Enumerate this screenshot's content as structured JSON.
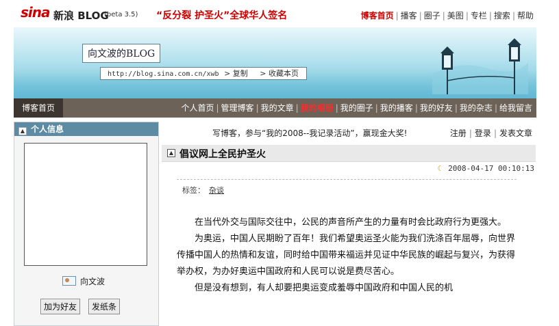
{
  "topbar": {
    "logo": "sina",
    "brand": "新浪 BLOG",
    "beta": "(beta 3.5)",
    "slogan": "“反分裂 护圣火”全球华人签名",
    "nav": [
      "博客首页",
      "播客",
      "圈子",
      "美图",
      "专栏",
      "搜索",
      "帮助"
    ]
  },
  "banner": {
    "blog_title": "向文波的BLOG",
    "url": "http://blog.sina.com.cn/xwb",
    "copy_label": "> 复制",
    "bookmark_label": "> 收藏本页"
  },
  "navbar": {
    "home": "博客首页",
    "links": [
      "个人首页",
      "管理博客",
      "我的文章",
      "我的相册",
      "我的圈子",
      "我的播客",
      "我的好友",
      "我的杂志",
      "给我留言"
    ],
    "active_index": 3
  },
  "profile": {
    "header": "个人信息",
    "name": "向文波",
    "add_friend": "加为好友",
    "send_note": "发纸条"
  },
  "infobar": {
    "promo": "写博客，参与“我的2008--我记录活动”，赢现金大奖!",
    "user_links": [
      "注册",
      "登录",
      "发表文章"
    ]
  },
  "post": {
    "title": "倡议网上全民护圣火",
    "date": "2008-04-17 00:10:13",
    "tag_label": "标签：",
    "tag": "杂谈",
    "paragraphs": [
      "在当代外交与国际交往中，公民的声音所产生的力量有时会比政府行为更强大。",
      "为奥运，中国人民期盼了百年！我们希望奥运圣火能为我们洗涤百年屈辱，向世界传播中国人的热情和友谊，同时给中国带来福运并见证中华民族的崛起与复兴，为获得举办权，为办好奥运中国政府和人民可以说是费尽苦心。",
      "但是没有想到，有人却要把奥运变成羞辱中国政府和中国人民的机"
    ]
  },
  "colors": {
    "brand_red": "#cc0000",
    "nav_bg": "#6c6258",
    "nav_active": "#ff2a2a",
    "panel_header": "#5c8ba3"
  }
}
